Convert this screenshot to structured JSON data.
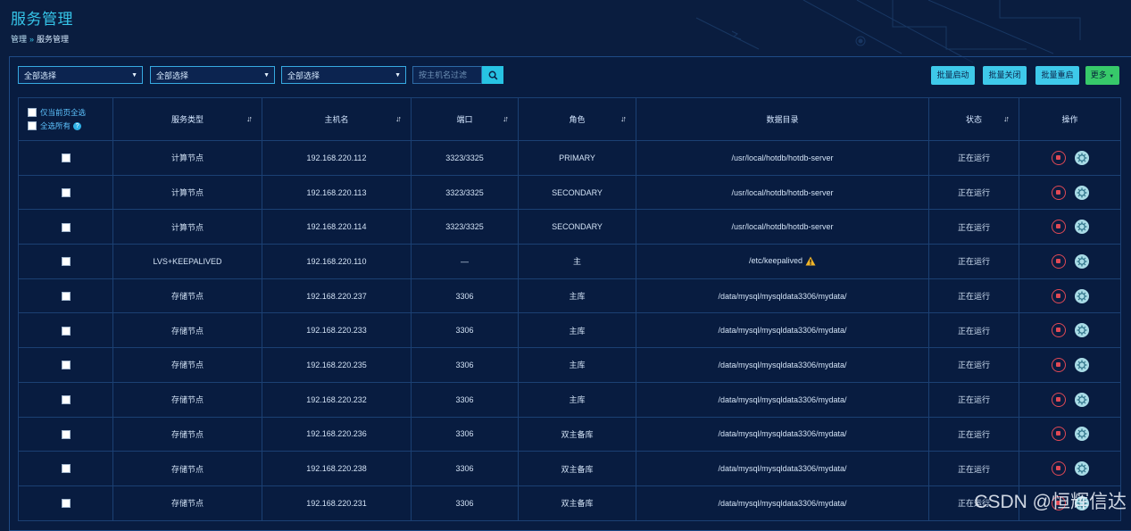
{
  "header": {
    "title": "服务管理",
    "breadcrumb": {
      "root": "管理",
      "separator": "»",
      "current": "服务管理"
    }
  },
  "filters": {
    "selects": [
      "全部选择",
      "全部选择",
      "全部选择"
    ],
    "search_placeholder": "按主机名过滤"
  },
  "toolbar": {
    "batch_start": "批量启动",
    "batch_stop": "批量关闭",
    "batch_restart": "批量重启",
    "more": "更多"
  },
  "table": {
    "select_page_label": "仅当前页全选",
    "select_all_label": "全选所有",
    "columns": [
      "服务类型",
      "主机名",
      "端口",
      "角色",
      "数据目录",
      "状态",
      "操作"
    ],
    "rows": [
      {
        "type": "计算节点",
        "host": "192.168.220.112",
        "port": "3323/3325",
        "role": "PRIMARY",
        "dir": "/usr/local/hotdb/hotdb-server",
        "status": "正在运行"
      },
      {
        "type": "计算节点",
        "host": "192.168.220.113",
        "port": "3323/3325",
        "role": "SECONDARY",
        "dir": "/usr/local/hotdb/hotdb-server",
        "status": "正在运行"
      },
      {
        "type": "计算节点",
        "host": "192.168.220.114",
        "port": "3323/3325",
        "role": "SECONDARY",
        "dir": "/usr/local/hotdb/hotdb-server",
        "status": "正在运行"
      },
      {
        "type": "LVS+KEEPALIVED",
        "host": "192.168.220.110",
        "port": "—",
        "role": "主",
        "dir": "/etc/keepalived",
        "status": "正在运行",
        "warning": true
      },
      {
        "type": "存储节点",
        "host": "192.168.220.237",
        "port": "3306",
        "role": "主库",
        "dir": "/data/mysql/mysqldata3306/mydata/",
        "status": "正在运行"
      },
      {
        "type": "存储节点",
        "host": "192.168.220.233",
        "port": "3306",
        "role": "主库",
        "dir": "/data/mysql/mysqldata3306/mydata/",
        "status": "正在运行"
      },
      {
        "type": "存储节点",
        "host": "192.168.220.235",
        "port": "3306",
        "role": "主库",
        "dir": "/data/mysql/mysqldata3306/mydata/",
        "status": "正在运行"
      },
      {
        "type": "存储节点",
        "host": "192.168.220.232",
        "port": "3306",
        "role": "主库",
        "dir": "/data/mysql/mysqldata3306/mydata/",
        "status": "正在运行"
      },
      {
        "type": "存储节点",
        "host": "192.168.220.236",
        "port": "3306",
        "role": "双主备库",
        "dir": "/data/mysql/mysqldata3306/mydata/",
        "status": "正在运行"
      },
      {
        "type": "存储节点",
        "host": "192.168.220.238",
        "port": "3306",
        "role": "双主备库",
        "dir": "/data/mysql/mysqldata3306/mydata/",
        "status": "正在运行"
      },
      {
        "type": "存储节点",
        "host": "192.168.220.231",
        "port": "3306",
        "role": "双主备库",
        "dir": "/data/mysql/mysqldata3306/mydata/",
        "status": "正在运行"
      }
    ]
  },
  "watermark": "CSDN @恒辉信达",
  "colors": {
    "background": "#0a1d3f",
    "accent": "#36c6ea",
    "button": "#3ec9ea",
    "more_button": "#37c96a",
    "status_running": "#40e36b",
    "stop_action": "#e04955",
    "warning": "#f0b429"
  },
  "icons": {
    "search": "search-icon",
    "sort": "sort-icon",
    "help": "help-icon",
    "warning": "warning-icon",
    "stop": "stop-icon",
    "config": "config-icon"
  }
}
